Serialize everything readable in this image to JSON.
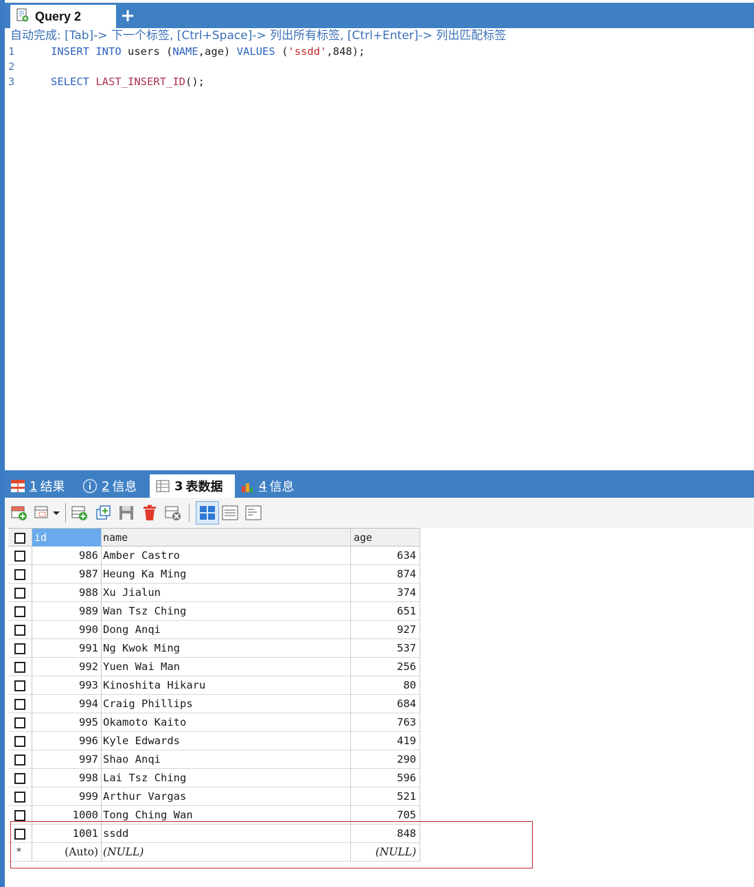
{
  "query_tab": {
    "label": "Query 2",
    "new_tab": "+"
  },
  "editor": {
    "autocomplete_hint": "自动完成: [Tab]-> 下一个标签, [Ctrl+Space]-> 列出所有标签, [Ctrl+Enter]-> 列出匹配标签",
    "lines": [
      {
        "num": "1",
        "t1": "INSERT",
        "t2": "INTO",
        "t3": "users",
        "t4": "(",
        "t5": "NAME",
        "t6": ",age)",
        "t7": "VALUES",
        "t8": "(",
        "t9": "'ssdd'",
        "t10": ",848);"
      },
      {
        "num": "2"
      },
      {
        "num": "3",
        "t1": "SELECT",
        "t2": "LAST_INSERT_ID",
        "t3": "();"
      }
    ]
  },
  "result_tabs": [
    {
      "num": "1",
      "label": "结果"
    },
    {
      "num": "2",
      "label": "信息"
    },
    {
      "num": "3",
      "label": "表数据"
    },
    {
      "num": "4",
      "label": "信息"
    }
  ],
  "grid": {
    "columns": [
      "id",
      "name",
      "age"
    ],
    "rows": [
      {
        "id": "986",
        "name": "Amber Castro",
        "age": "634"
      },
      {
        "id": "987",
        "name": "Heung Ka Ming",
        "age": "874"
      },
      {
        "id": "988",
        "name": "Xu Jialun",
        "age": "374"
      },
      {
        "id": "989",
        "name": "Wan Tsz Ching",
        "age": "651"
      },
      {
        "id": "990",
        "name": "Dong Anqi",
        "age": "927"
      },
      {
        "id": "991",
        "name": "Ng Kwok Ming",
        "age": "537"
      },
      {
        "id": "992",
        "name": "Yuen Wai Man",
        "age": "256"
      },
      {
        "id": "993",
        "name": "Kinoshita Hikaru",
        "age": "80"
      },
      {
        "id": "994",
        "name": "Craig Phillips",
        "age": "684"
      },
      {
        "id": "995",
        "name": "Okamoto Kaito",
        "age": "763"
      },
      {
        "id": "996",
        "name": "Kyle Edwards",
        "age": "419"
      },
      {
        "id": "997",
        "name": "Shao Anqi",
        "age": "290"
      },
      {
        "id": "998",
        "name": "Lai Tsz Ching",
        "age": "596"
      },
      {
        "id": "999",
        "name": "Arthur Vargas",
        "age": "521"
      },
      {
        "id": "1000",
        "name": "Tong Ching Wan",
        "age": "705"
      },
      {
        "id": "1001",
        "name": "ssdd",
        "age": "848"
      }
    ],
    "new_row": {
      "marker": "*",
      "id": "(Auto)",
      "name": "(NULL)",
      "age": "(NULL)"
    }
  },
  "colors": {
    "accent": "#3f80c4",
    "highlight_border": "#c0252f",
    "selected_header": "#6aa9ec"
  }
}
